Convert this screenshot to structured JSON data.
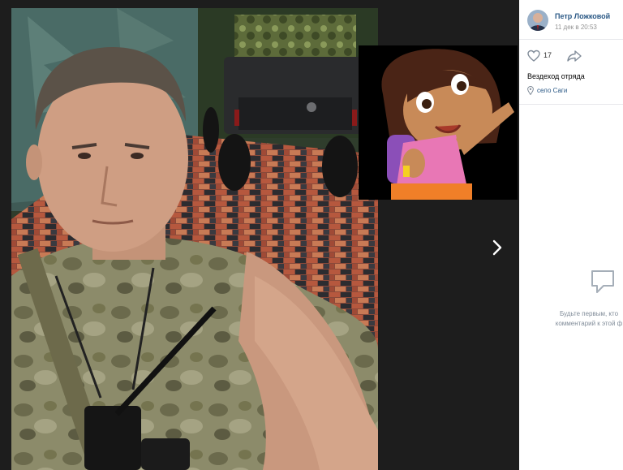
{
  "post": {
    "author_name": "Петр Ложковой",
    "date": "11 дек в 20:53",
    "likes": "17",
    "caption": "Вездеход отряда",
    "location": "село Саги"
  },
  "comments": {
    "empty_line1": "Будьте первым, кто",
    "empty_line2": "комментарий к этой ф"
  },
  "icons": {
    "like": "heart-icon",
    "share": "share-icon",
    "location": "pin-icon",
    "comment": "comment-bubble-icon",
    "next": "chevron-right-icon"
  },
  "colors": {
    "link": "#2a5885",
    "muted": "#939393",
    "viewer_bg": "#1d1d1d"
  }
}
